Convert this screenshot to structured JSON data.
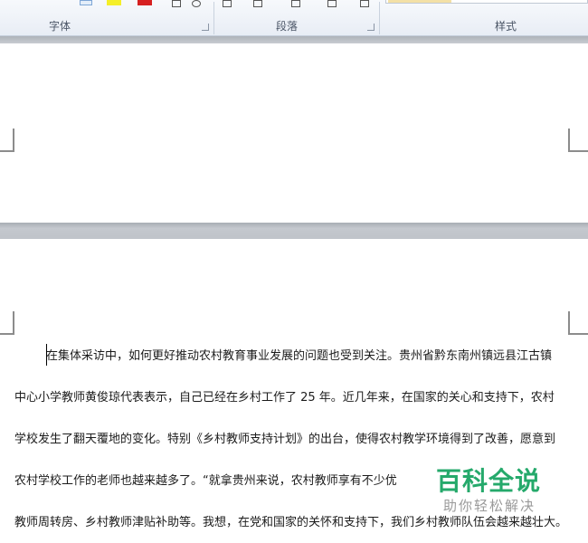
{
  "ribbon": {
    "groups": [
      {
        "label": "字体"
      },
      {
        "label": "段落"
      },
      {
        "label": "样式"
      }
    ]
  },
  "document": {
    "lines": [
      "在集体采访中，如何更好推动农村教育事业发展的问题也受到关注。贵州省黔东南州镇远县江古镇",
      "中心小学教师黄俊琼代表表示，自己已经在乡村工作了 25 年。近几年来，在国家的关心和支持下，农村",
      "学校发生了翻天覆地的变化。特别《乡村教师支持计划》的出台，使得农村教学环境得到了改善，愿意到",
      "农村学校工作的老师也越来越多了。“就拿贵州来说，农村教师享有不少优",
      "教师周转房、乡村教师津贴补助等。我想，在党和国家的关怀和支持下，我们乡村教师队伍会越来越壮大。"
    ]
  },
  "watermark": {
    "title": "百科全说",
    "subtitle": "助你轻松解决"
  },
  "colors": {
    "highlight": "#f5ef28",
    "font_color": "#d62020",
    "watermark": "#25a96b"
  }
}
